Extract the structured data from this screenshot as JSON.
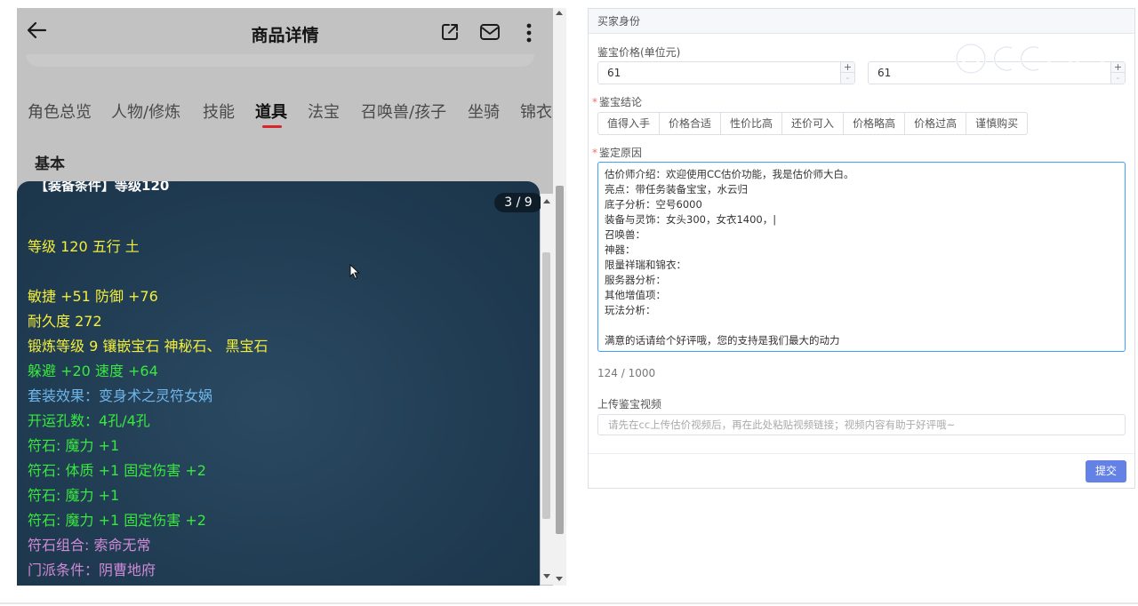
{
  "phone": {
    "title": "商品详情",
    "tabs": [
      "角色总览",
      "人物/修炼",
      "技能",
      "道具",
      "法宝",
      "召唤兽/孩子",
      "坐骑",
      "锦衣"
    ],
    "active_tab": "道具",
    "section": "基本",
    "card_cut_text": "【装备条件】等级120",
    "counter": "3 / 9",
    "lines": [
      "等级 120 五行 土",
      "敏捷 +51 防御 +76",
      "耐久度 272",
      "锻炼等级 9 镶嵌宝石 神秘石、 黑宝石",
      "躲避 +20 速度 +64",
      "套装效果：变身术之灵符女娲",
      "开运孔数：4孔/4孔",
      "符石: 魔力 +1",
      "符石: 体质 +1 固定伤害 +2",
      "符石: 魔力 +1",
      "符石: 魔力 +1 固定伤害 +2",
      "符石组合: 索命无常",
      "门派条件：阴曹地府"
    ],
    "colors": {
      "yellow": "#f3ee3a",
      "green": "#39e83e",
      "blue": "#6fb6ea",
      "purple": "#d08ad6",
      "card_bg": "#223f56",
      "tab_underline": "#d8252c"
    },
    "icons": [
      "back-arrow-icon",
      "share-icon",
      "mail-icon",
      "more-vertical-icon",
      "mouse-cursor-icon"
    ]
  },
  "form": {
    "panel_header": "买家身份",
    "price_label": "鉴宝价格(单位元)",
    "price_min": "61",
    "price_max": "61",
    "plus": "+",
    "minus": "-",
    "conclusion_label": "鉴宝结论",
    "conclusions": [
      "值得入手",
      "价格合适",
      "性价比高",
      "还价可入",
      "价格略高",
      "价格过高",
      "谨慎购买"
    ],
    "reason_label": "鉴定原因",
    "reason_lines": [
      "估价师介绍：欢迎使用CC估价功能，我是估价师大白。",
      "亮点：带任务装备宝宝，水云归",
      "底子分析：空号6000",
      "装备与灵饰：女头300，女衣1400，|",
      "召唤兽：",
      "神器：",
      "限量祥瑞和锦衣：",
      "服务器分析：",
      "其他增值项：",
      "玩法分析：",
      "",
      "满意的话请给个好评哦，您的支持是我们最大的动力"
    ],
    "char_count": "124 / 1000",
    "video_label": "上传鉴宝视频",
    "video_placeholder": "请先在cc上传估价视频后，再在此处粘贴视频链接；视频内容有助于好评哦~",
    "submit": "提交",
    "required_mark": "*",
    "colors": {
      "submit_bg": "#6482e6",
      "focus_border": "#409eff",
      "required": "#f56c6c"
    }
  }
}
